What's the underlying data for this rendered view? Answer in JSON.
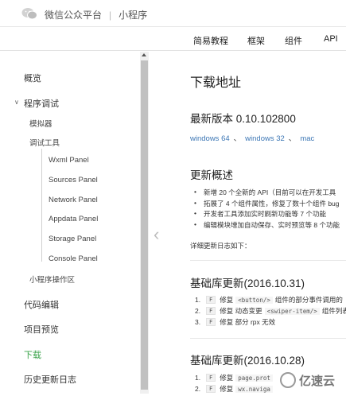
{
  "header": {
    "platform": "微信公众平台",
    "separator": "|",
    "product": "小程序"
  },
  "nav": [
    "简易教程",
    "框架",
    "组件",
    "API"
  ],
  "sidebar": {
    "overview": "概览",
    "debug": "程序调试",
    "simulator": "模拟器",
    "devtools": "调试工具",
    "panels": [
      "Wxml Panel",
      "Sources Panel",
      "Network Panel",
      "Appdata Panel",
      "Storage Panel",
      "Console Panel"
    ],
    "operation_area": "小程序操作区",
    "code_edit": "代码编辑",
    "project_preview": "项目预览",
    "download": "下载",
    "history": "历史更新日志"
  },
  "main": {
    "title": "下载地址",
    "latest_version": "最新版本 0.10.102800",
    "links": [
      "windows 64",
      "windows 32",
      "mac"
    ],
    "overview_title": "更新概述",
    "overview_items": [
      "新增 20 个全新的 API（目前可以在开发工具",
      "拓展了 4 个组件属性，修复了数十个组件 bug",
      "开发者工具添加实时刷新功能等 7 个功能",
      "编辑模块增加自动保存、实时预览等 8 个功能"
    ],
    "detail_note": "详细更新日志如下：",
    "lib_update_1": {
      "title": "基础库更新(2016.10.31)",
      "items": [
        {
          "num": "1.",
          "tag": "F",
          "pre": "修复",
          "code": "<button/>",
          "post": "组件的部分事件调用的"
        },
        {
          "num": "2.",
          "tag": "F",
          "pre": "修复 动态变更",
          "code": "<swiper-item/>",
          "post": "组件列表"
        },
        {
          "num": "3.",
          "tag": "F",
          "pre": "修复 部分 rpx 无效",
          "code": "",
          "post": ""
        }
      ]
    },
    "lib_update_2": {
      "title": "基础库更新(2016.10.28)",
      "items": [
        {
          "num": "1.",
          "tag": "F",
          "pre": "修复",
          "code": "page.prot",
          "post": ""
        },
        {
          "num": "2.",
          "tag": "F",
          "pre": "修复",
          "code": "wx.naviga",
          "post": ""
        }
      ]
    }
  },
  "watermark": "亿速云",
  "colors": {
    "active_green": "#3aa34a",
    "link_blue": "#3d77b5"
  }
}
